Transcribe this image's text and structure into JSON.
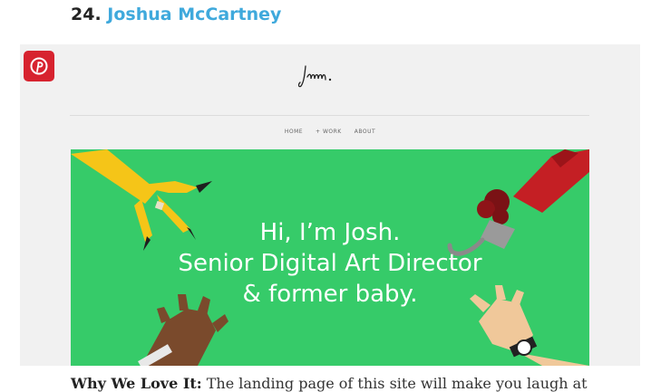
{
  "entry": {
    "number": "24.",
    "name": "Joshua McCartney"
  },
  "screenshot": {
    "logo_text": "Jmm.",
    "nav": [
      "HOME",
      "+ WORK",
      "ABOUT"
    ],
    "hero_lines": [
      "Hi, I’m Josh.",
      "Senior Digital Art Director",
      "& former baby."
    ],
    "colors": {
      "hero_bg": "#36cb69",
      "pin_button": "#d7232f",
      "link": "#3fa9dc"
    }
  },
  "pin_icon": "pinterest-icon",
  "caption": {
    "lead": "Why We Love It:",
    "text": " The landing page of this site will make you laugh at"
  }
}
